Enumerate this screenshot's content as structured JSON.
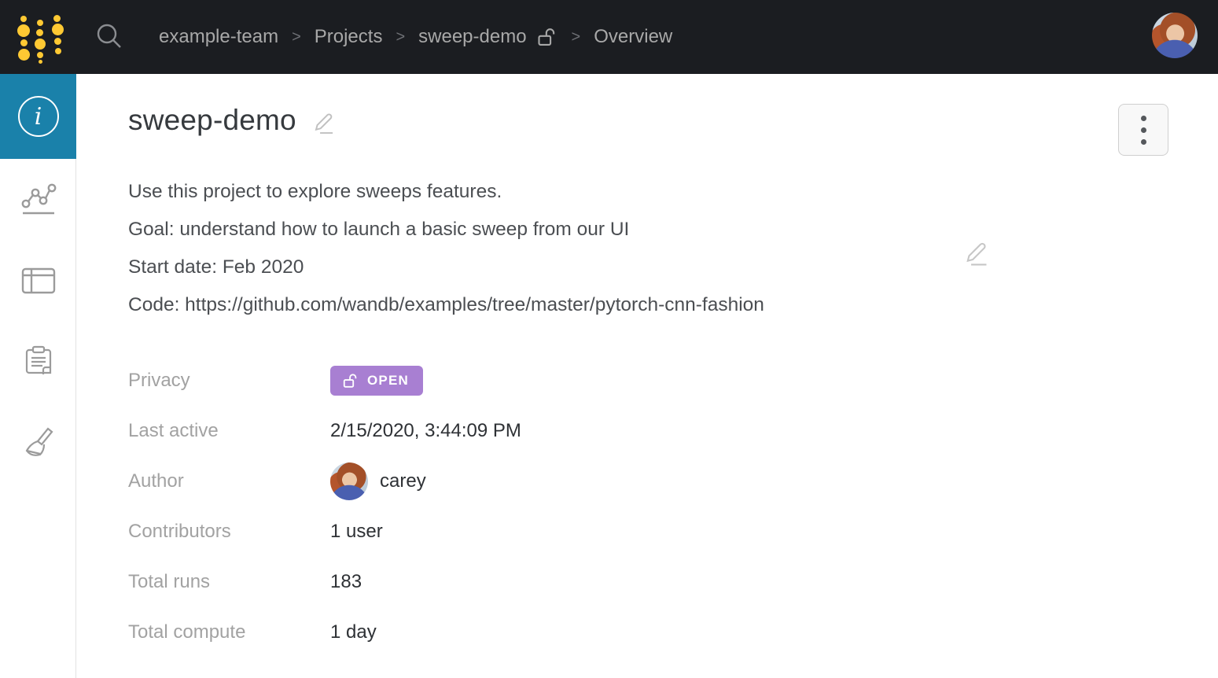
{
  "topbar": {
    "breadcrumb": [
      {
        "label": "example-team"
      },
      {
        "label": "Projects"
      },
      {
        "label": "sweep-demo"
      },
      {
        "label": "Overview"
      }
    ],
    "separator": ">"
  },
  "sidebar": {
    "items": [
      {
        "name": "overview",
        "icon": "info-icon",
        "active": true
      },
      {
        "name": "workspace",
        "icon": "line-chart-icon",
        "active": false
      },
      {
        "name": "table",
        "icon": "table-icon",
        "active": false
      },
      {
        "name": "reports",
        "icon": "clipboard-icon",
        "active": false
      },
      {
        "name": "sweeps",
        "icon": "broom-icon",
        "active": false
      }
    ]
  },
  "main": {
    "title": "sweep-demo",
    "description_lines": [
      "Use this project to explore sweeps features.",
      "Goal: understand how to launch a basic sweep from our UI",
      "Start date: Feb 2020",
      "Code: https://github.com/wandb/examples/tree/master/pytorch-cnn-fashion"
    ],
    "details": {
      "privacy_label": "Privacy",
      "privacy_value": "OPEN",
      "last_active_label": "Last active",
      "last_active_value": "2/15/2020, 3:44:09 PM",
      "author_label": "Author",
      "author_value": "carey",
      "contributors_label": "Contributors",
      "contributors_value": "1 user",
      "total_runs_label": "Total runs",
      "total_runs_value": "183",
      "total_compute_label": "Total compute",
      "total_compute_value": "1 day"
    }
  },
  "colors": {
    "topbar_bg": "#1b1d21",
    "accent_teal": "#1a81aa",
    "badge_purple": "#a87fd2",
    "logo_gold": "#ffc933"
  }
}
